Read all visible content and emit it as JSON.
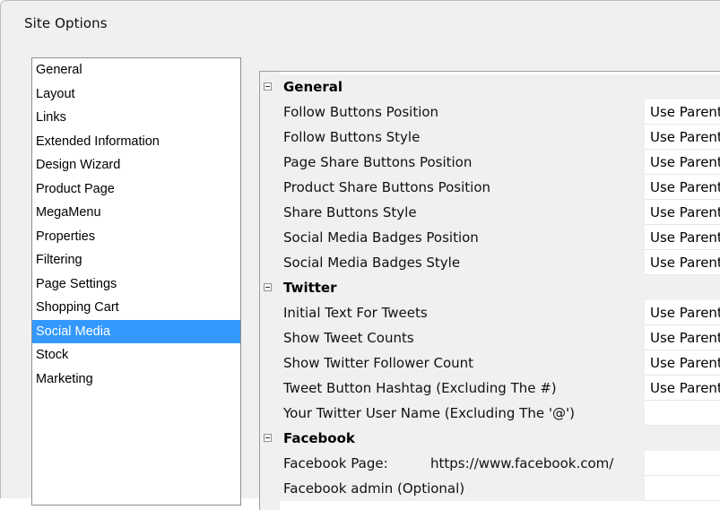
{
  "window": {
    "title": "Site Options"
  },
  "nav": {
    "items": [
      {
        "label": "General"
      },
      {
        "label": "Layout"
      },
      {
        "label": "Links"
      },
      {
        "label": "Extended Information"
      },
      {
        "label": "Design Wizard"
      },
      {
        "label": "Product Page"
      },
      {
        "label": "MegaMenu"
      },
      {
        "label": "Properties"
      },
      {
        "label": "Filtering"
      },
      {
        "label": "Page Settings"
      },
      {
        "label": "Shopping Cart"
      },
      {
        "label": "Social Media",
        "selected": true
      },
      {
        "label": "Stock"
      },
      {
        "label": "Marketing"
      }
    ]
  },
  "grid": {
    "categories": [
      {
        "label": "General",
        "expander_icon": "collapse-minus-icon",
        "properties": [
          {
            "name": "Follow Buttons Position",
            "value": "Use Parent"
          },
          {
            "name": "Follow Buttons Style",
            "value": "Use Parent"
          },
          {
            "name": "Page Share Buttons Position",
            "value": "Use Parent"
          },
          {
            "name": "Product Share Buttons Position",
            "value": "Use Parent"
          },
          {
            "name": "Share Buttons Style",
            "value": "Use Parent"
          },
          {
            "name": "Social Media Badges Position",
            "value": "Use Parent"
          },
          {
            "name": "Social Media Badges Style",
            "value": "Use Parent"
          }
        ]
      },
      {
        "label": "Twitter",
        "expander_icon": "collapse-minus-icon",
        "properties": [
          {
            "name": "Initial Text For Tweets",
            "value": "Use Parent"
          },
          {
            "name": "Show Tweet Counts",
            "value": "Use Parent"
          },
          {
            "name": "Show Twitter Follower Count",
            "value": "Use Parent"
          },
          {
            "name": "Tweet Button Hashtag (Excluding The #)",
            "value": "Use Parent"
          },
          {
            "name": "Your Twitter User Name (Excluding The '@')",
            "value": ""
          }
        ]
      },
      {
        "label": "Facebook",
        "expander_icon": "collapse-minus-icon",
        "properties": [
          {
            "name": "Facebook Page:",
            "url": "https://www.facebook.com/",
            "value": ""
          },
          {
            "name": "Facebook admin (Optional)",
            "value": ""
          }
        ]
      }
    ]
  },
  "colors": {
    "selection": "#3399ff",
    "panel_bg": "#f0f0f0",
    "grid_bg": "#ffffff"
  }
}
